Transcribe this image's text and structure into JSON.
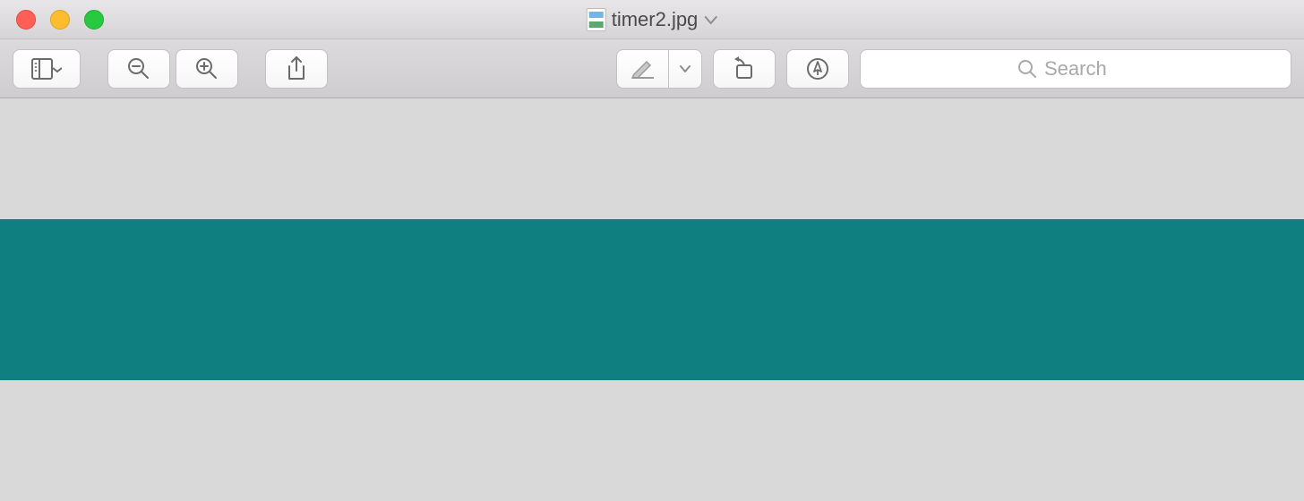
{
  "window": {
    "title": "timer2.jpg"
  },
  "toolbar": {
    "sidebar_label": "Sidebar",
    "zoom_out_label": "Zoom Out",
    "zoom_in_label": "Zoom In",
    "share_label": "Share",
    "markup_label": "Markup",
    "rotate_label": "Rotate",
    "annotate_label": "Annotate"
  },
  "search": {
    "placeholder": "Search"
  },
  "content": {
    "strip_color": "#0f7f7f"
  }
}
